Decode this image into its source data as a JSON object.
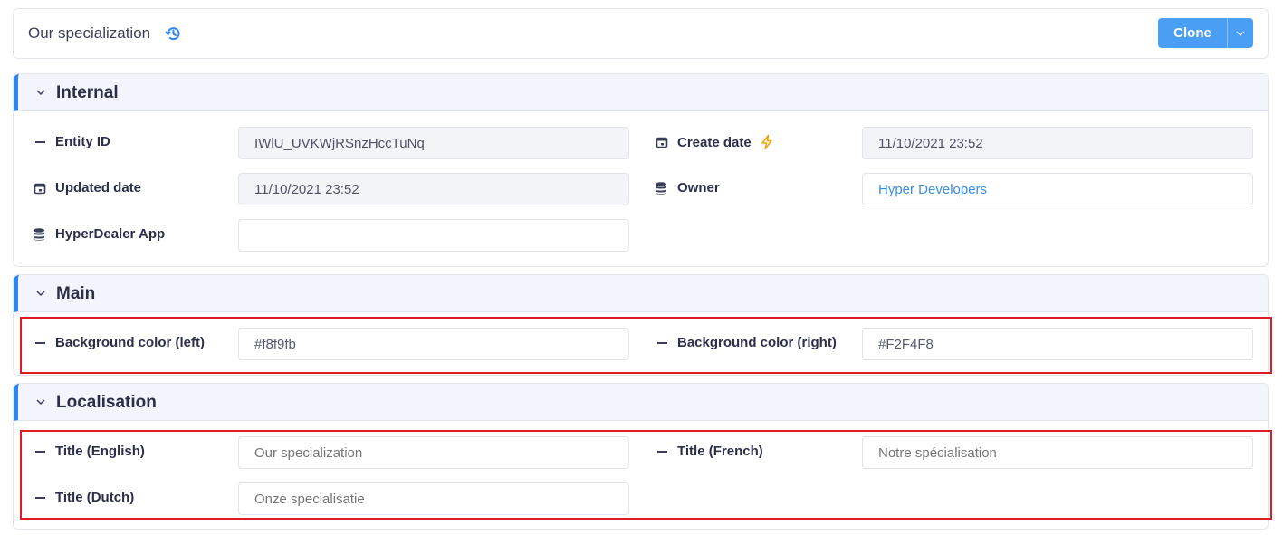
{
  "header": {
    "title": "Our specialization",
    "history_icon": "history-icon",
    "clone_label": "Clone",
    "clone_caret_icon": "chevron-down-icon"
  },
  "sections": {
    "internal": {
      "title": "Internal",
      "fields": {
        "entity_id": {
          "label": "Entity ID",
          "value": "IWlU_UVKWjRSnzHccTuNq",
          "icon": "dash-icon"
        },
        "create_date": {
          "label": "Create date",
          "value": "11/10/2021 23:52",
          "icon": "calendar-icon",
          "extra_icon": "lightning-icon"
        },
        "updated_date": {
          "label": "Updated date",
          "value": "11/10/2021 23:52",
          "icon": "calendar-icon"
        },
        "owner": {
          "label": "Owner",
          "value": "Hyper Developers",
          "icon": "database-icon"
        },
        "hyperdealer_app": {
          "label": "HyperDealer App",
          "value": "",
          "icon": "database-icon"
        }
      }
    },
    "main": {
      "title": "Main",
      "fields": {
        "bg_left": {
          "label": "Background color (left)",
          "value": "#f8f9fb",
          "icon": "dash-icon"
        },
        "bg_right": {
          "label": "Background color (right)",
          "value": "#F2F4F8",
          "icon": "dash-icon"
        }
      }
    },
    "localisation": {
      "title": "Localisation",
      "fields": {
        "title_en": {
          "label": "Title (English)",
          "placeholder": "Our specialization",
          "icon": "dash-icon"
        },
        "title_fr": {
          "label": "Title (French)",
          "placeholder": "Notre spécialisation",
          "icon": "dash-icon"
        },
        "title_nl": {
          "label": "Title (Dutch)",
          "placeholder": "Onze specialisatie",
          "icon": "dash-icon"
        }
      }
    }
  },
  "colors": {
    "accent": "#2f86eb",
    "button": "#4a9ff5",
    "highlight": "#e01b24",
    "link": "#3a8fe0"
  }
}
